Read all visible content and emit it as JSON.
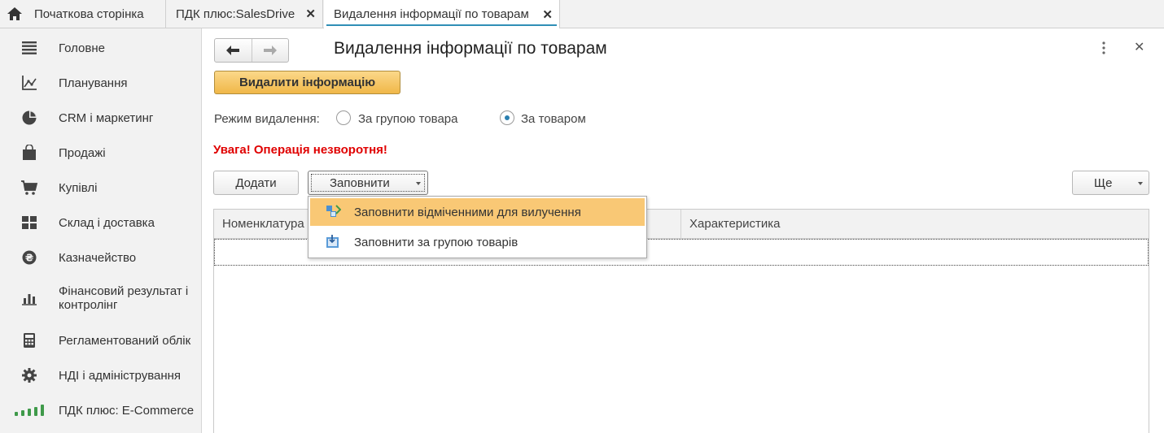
{
  "tabs": [
    {
      "label": "Початкова сторінка"
    },
    {
      "label": "ПДК плюс:SalesDrive"
    },
    {
      "label": "Видалення інформації по товарам"
    }
  ],
  "tab_close_glyph": "✕",
  "sidebar": {
    "items": [
      {
        "label": "Головне",
        "icon": "menu-icon"
      },
      {
        "label": "Планування",
        "icon": "axes-chart-icon"
      },
      {
        "label": "CRM і маркетинг",
        "icon": "pie-chart-icon"
      },
      {
        "label": "Продажі",
        "icon": "shopping-bag-icon"
      },
      {
        "label": "Купівлі",
        "icon": "cart-icon"
      },
      {
        "label": "Склад і доставка",
        "icon": "grid-icon"
      },
      {
        "label": "Казначейство",
        "icon": "coin-icon"
      },
      {
        "label": "Фінансовий результат і контролінг",
        "icon": "bar-chart-icon"
      },
      {
        "label": "Регламентований облік",
        "icon": "calculator-icon"
      },
      {
        "label": "НДІ і адміністрування",
        "icon": "gear-icon"
      },
      {
        "label": "ПДК плюс: E-Commerce",
        "icon": "signal-icon"
      }
    ]
  },
  "form": {
    "title": "Видалення інформації по товарам",
    "delete_button": "Видалити інформацію",
    "mode_label": "Режим видалення:",
    "mode_options": [
      {
        "label": "За групою товара",
        "checked": false
      },
      {
        "label": "За товаром",
        "checked": true
      }
    ],
    "warning": "Увага! Операція незворотня!",
    "add_button": "Додати",
    "fill_button": "Заповнити",
    "more_button": "Ще",
    "table": {
      "columns": [
        "Номенклатура",
        "Характеристика"
      ]
    },
    "fill_menu": [
      {
        "label": "Заповнити відміченними для вилучення",
        "highlighted": true
      },
      {
        "label": "Заповнити за групою товарів",
        "highlighted": false
      }
    ]
  },
  "colors": {
    "accent_tab": "#2f8fb6",
    "primary_button": "#f0b748",
    "warning": "#e00000",
    "menu_highlight": "#f9c875",
    "sidebar_bg": "#f2f2f2"
  }
}
